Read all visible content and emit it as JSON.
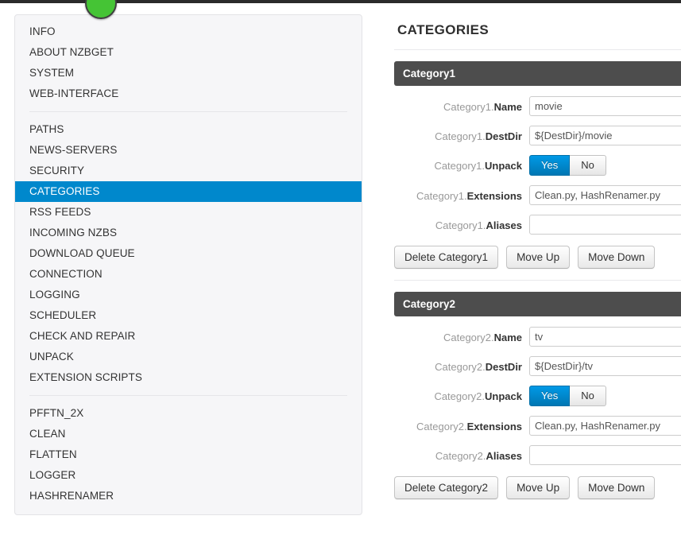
{
  "navbar": {
    "status_indicator": "green-status-dot",
    "background_color": "#2b2b2b",
    "status_color": "#45c435"
  },
  "sidebar": {
    "groups": [
      {
        "items": [
          {
            "label": "INFO",
            "active": false
          },
          {
            "label": "ABOUT NZBGET",
            "active": false
          },
          {
            "label": "SYSTEM",
            "active": false
          },
          {
            "label": "WEB-INTERFACE",
            "active": false
          }
        ]
      },
      {
        "items": [
          {
            "label": "PATHS",
            "active": false
          },
          {
            "label": "NEWS-SERVERS",
            "active": false
          },
          {
            "label": "SECURITY",
            "active": false
          },
          {
            "label": "CATEGORIES",
            "active": true
          },
          {
            "label": "RSS FEEDS",
            "active": false
          },
          {
            "label": "INCOMING NZBS",
            "active": false
          },
          {
            "label": "DOWNLOAD QUEUE",
            "active": false
          },
          {
            "label": "CONNECTION",
            "active": false
          },
          {
            "label": "LOGGING",
            "active": false
          },
          {
            "label": "SCHEDULER",
            "active": false
          },
          {
            "label": "CHECK AND REPAIR",
            "active": false
          },
          {
            "label": "UNPACK",
            "active": false
          },
          {
            "label": "EXTENSION SCRIPTS",
            "active": false
          }
        ]
      },
      {
        "items": [
          {
            "label": "PFFTN_2X",
            "active": false
          },
          {
            "label": "CLEAN",
            "active": false
          },
          {
            "label": "FLATTEN",
            "active": false
          },
          {
            "label": "LOGGER",
            "active": false
          },
          {
            "label": "HASHRENAMER",
            "active": false
          }
        ]
      }
    ],
    "active_color": "#0088cc"
  },
  "main": {
    "title": "CATEGORIES",
    "header_color": "#4d4d4d",
    "categories": [
      {
        "header": "Category1",
        "fields": [
          {
            "prefix": "Category1.",
            "name": "Name",
            "value": "movie"
          },
          {
            "prefix": "Category1.",
            "name": "DestDir",
            "value": "${DestDir}/movie"
          },
          {
            "prefix": "Category1.",
            "name": "Extensions",
            "value": "Clean.py, HashRenamer.py"
          },
          {
            "prefix": "Category1.",
            "name": "Aliases",
            "value": ""
          }
        ],
        "unpack": {
          "prefix": "Category1.",
          "name": "Unpack",
          "yes_label": "Yes",
          "no_label": "No",
          "selected": "Yes"
        },
        "buttons": {
          "delete_label": "Delete Category1",
          "move_up_label": "Move Up",
          "move_down_label": "Move Down"
        }
      },
      {
        "header": "Category2",
        "fields": [
          {
            "prefix": "Category2.",
            "name": "Name",
            "value": "tv"
          },
          {
            "prefix": "Category2.",
            "name": "DestDir",
            "value": "${DestDir}/tv"
          },
          {
            "prefix": "Category2.",
            "name": "Extensions",
            "value": "Clean.py, HashRenamer.py"
          },
          {
            "prefix": "Category2.",
            "name": "Aliases",
            "value": ""
          }
        ],
        "unpack": {
          "prefix": "Category2.",
          "name": "Unpack",
          "yes_label": "Yes",
          "no_label": "No",
          "selected": "Yes"
        },
        "buttons": {
          "delete_label": "Delete Category2",
          "move_up_label": "Move Up",
          "move_down_label": "Move Down"
        }
      }
    ]
  }
}
